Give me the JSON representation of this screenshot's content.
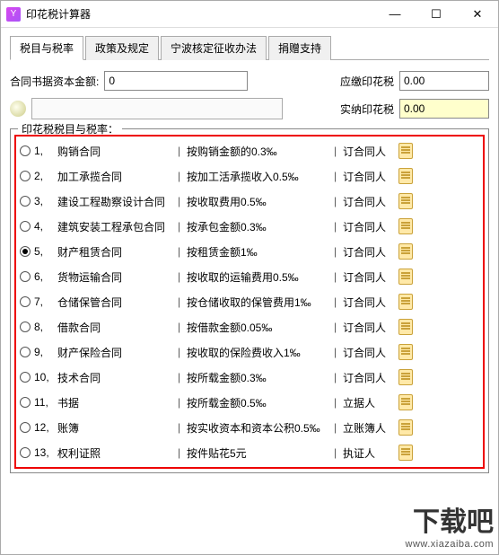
{
  "window": {
    "title": "印花税计算器",
    "min": "—",
    "max": "☐",
    "close": "✕"
  },
  "tabs": [
    {
      "label": "税目与税率",
      "active": true
    },
    {
      "label": "政策及规定",
      "active": false
    },
    {
      "label": "宁波核定征收办法",
      "active": false
    },
    {
      "label": "捐赠支持",
      "active": false
    }
  ],
  "inputs": {
    "amount_label": "合同书据资本金额:",
    "amount_value": "0",
    "due_label": "应缴印花税",
    "due_value": "0.00",
    "paid_label": "实纳印花税",
    "paid_value": "0.00"
  },
  "fieldset_legend": "印花税税目与税率：",
  "selected_index": 5,
  "items": [
    {
      "idx": "1,",
      "name": "购销合同",
      "rate": "按购销金额的0.3‰",
      "payer": "订合同人"
    },
    {
      "idx": "2,",
      "name": "加工承揽合同",
      "rate": "按加工活承揽收入0.5‰",
      "payer": "订合同人"
    },
    {
      "idx": "3,",
      "name": "建设工程勘察设计合同",
      "rate": "按收取费用0.5‰",
      "payer": "订合同人"
    },
    {
      "idx": "4,",
      "name": "建筑安装工程承包合同",
      "rate": "按承包金额0.3‰",
      "payer": "订合同人"
    },
    {
      "idx": "5,",
      "name": "财产租赁合同",
      "rate": "按租赁金额1‰",
      "payer": "订合同人"
    },
    {
      "idx": "6,",
      "name": "货物运输合同",
      "rate": "按收取的运输费用0.5‰",
      "payer": "订合同人"
    },
    {
      "idx": "7,",
      "name": "仓储保管合同",
      "rate": "按仓储收取的保管费用1‰",
      "payer": "订合同人"
    },
    {
      "idx": "8,",
      "name": "借款合同",
      "rate": "按借款金额0.05‰",
      "payer": "订合同人"
    },
    {
      "idx": "9,",
      "name": "财产保险合同",
      "rate": "按收取的保险费收入1‰",
      "payer": "订合同人"
    },
    {
      "idx": "10,",
      "name": "技术合同",
      "rate": "按所载金额0.3‰",
      "payer": "订合同人"
    },
    {
      "idx": "11,",
      "name": "书据",
      "rate": "按所载金额0.5‰",
      "payer": "立据人"
    },
    {
      "idx": "12,",
      "name": "账簿",
      "rate": "按实收资本和资本公积0.5‰",
      "payer": "立账簿人"
    },
    {
      "idx": "13,",
      "name": "权利证照",
      "rate": "按件贴花5元",
      "payer": "执证人"
    }
  ],
  "watermark": {
    "big": "下载吧",
    "url": "www.xiazaiba.com"
  }
}
